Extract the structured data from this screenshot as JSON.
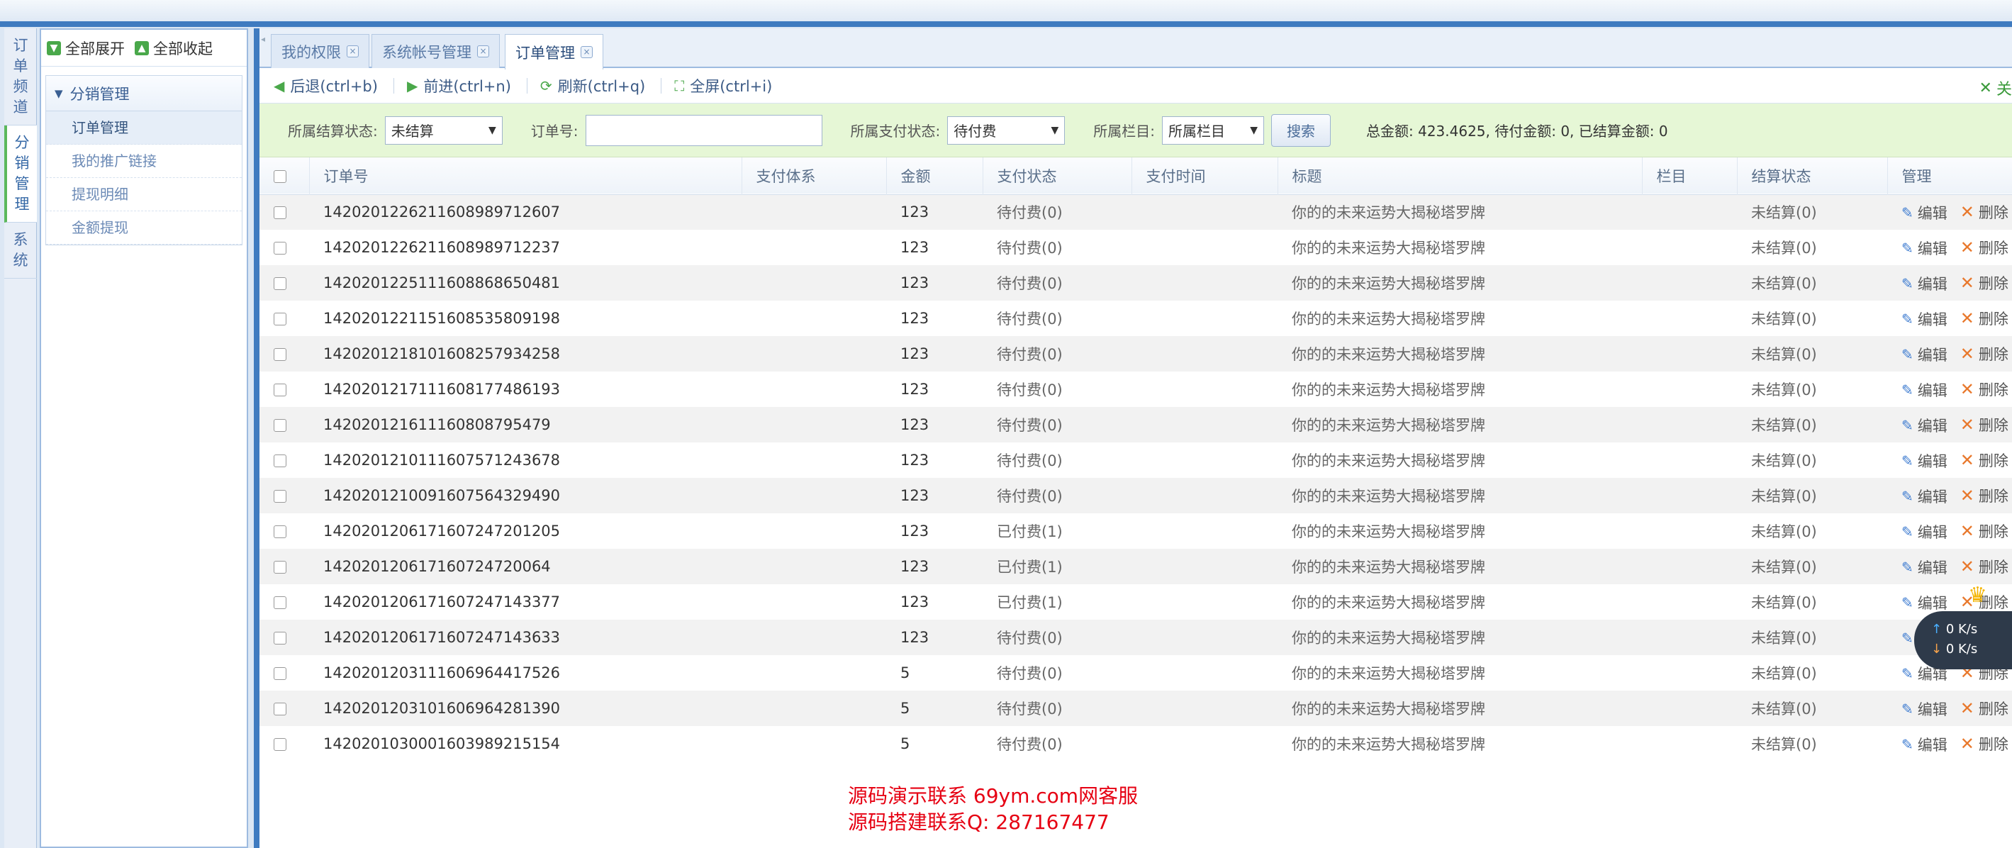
{
  "channels": [
    {
      "label": "订单频道",
      "active": false
    },
    {
      "label": "分销管理",
      "active": true
    },
    {
      "label": "系统",
      "active": false
    }
  ],
  "tree": {
    "expand_all": "全部展开",
    "collapse_all": "全部收起",
    "group": "分销管理",
    "items": [
      "订单管理",
      "我的推广链接",
      "提现明细",
      "金额提现"
    ]
  },
  "tabs": [
    {
      "label": "我的权限"
    },
    {
      "label": "系统帐号管理"
    },
    {
      "label": "订单管理"
    }
  ],
  "toolbar": {
    "back": "后退(ctrl+b)",
    "forward": "前进(ctrl+n)",
    "refresh": "刷新(ctrl+q)",
    "fullscreen": "全屏(ctrl+i)",
    "close_partial": "关"
  },
  "filter": {
    "settle_label": "所属结算状态:",
    "settle_value": "未结算",
    "order_label": "订单号:",
    "order_value": "",
    "pay_label": "所属支付状态:",
    "pay_value": "待付费",
    "column_label": "所属栏目:",
    "column_value": "所属栏目",
    "search_btn": "搜索",
    "summary": "总金额: 423.4625, 待付金额: 0, 已结算金额: 0"
  },
  "table": {
    "headers": [
      "订单号",
      "支付体系",
      "金额",
      "支付状态",
      "支付时间",
      "标题",
      "栏目",
      "结算状态",
      "管理"
    ],
    "edit_label": "编辑",
    "delete_label": "删除",
    "rows": [
      {
        "order": "14202012262116089897126​07",
        "system": "",
        "amount": "123",
        "pay": "待付费(0)",
        "time": "",
        "title": "你的的未来运势大揭秘塔罗牌",
        "column": "",
        "settle": "未结算(0)"
      },
      {
        "order": "142020122621160898971223​7",
        "system": "",
        "amount": "123",
        "pay": "待付费(0)",
        "time": "",
        "title": "你的的未来运势大揭秘塔罗牌",
        "column": "",
        "settle": "未结算(0)"
      },
      {
        "order": "1420201225111608868650481",
        "system": "",
        "amount": "123",
        "pay": "待付费(0)",
        "time": "",
        "title": "你的的未来运势大揭秘塔罗牌",
        "column": "",
        "settle": "未结算(0)"
      },
      {
        "order": "1420201221151608535809198",
        "system": "",
        "amount": "123",
        "pay": "待付费(0)",
        "time": "",
        "title": "你的的未来运势大揭秘塔罗牌",
        "column": "",
        "settle": "未结算(0)"
      },
      {
        "order": "1420201218101608257934258",
        "system": "",
        "amount": "123",
        "pay": "待付费(0)",
        "time": "",
        "title": "你的的未来运势大揭秘塔罗牌",
        "column": "",
        "settle": "未结算(0)"
      },
      {
        "order": "1420201217111608177486193",
        "system": "",
        "amount": "123",
        "pay": "待付费(0)",
        "time": "",
        "title": "你的的未来运势大揭秘塔罗牌",
        "column": "",
        "settle": "未结算(0)"
      },
      {
        "order": "142020121611160808795479",
        "system": "",
        "amount": "123",
        "pay": "待付费(0)",
        "time": "",
        "title": "你的的未来运势大揭秘塔罗牌",
        "column": "",
        "settle": "未结算(0)"
      },
      {
        "order": "1420201210111607571243678",
        "system": "",
        "amount": "123",
        "pay": "待付费(0)",
        "time": "",
        "title": "你的的未来运势大揭秘塔罗牌",
        "column": "",
        "settle": "未结算(0)"
      },
      {
        "order": "1420201210091607564329490",
        "system": "",
        "amount": "123",
        "pay": "待付费(0)",
        "time": "",
        "title": "你的的未来运势大揭秘塔罗牌",
        "column": "",
        "settle": "未结算(0)"
      },
      {
        "order": "1420201206171607247201205",
        "system": "",
        "amount": "123",
        "pay": "已付费(1)",
        "time": "",
        "title": "你的的未来运势大揭秘塔罗牌",
        "column": "",
        "settle": "未结算(0)"
      },
      {
        "order": "142020120617160724720064",
        "system": "",
        "amount": "123",
        "pay": "已付费(1)",
        "time": "",
        "title": "你的的未来运势大揭秘塔罗牌",
        "column": "",
        "settle": "未结算(0)"
      },
      {
        "order": "1420201206171607247143377",
        "system": "",
        "amount": "123",
        "pay": "已付费(1)",
        "time": "",
        "title": "你的的未来运势大揭秘塔罗牌",
        "column": "",
        "settle": "未结算(0)"
      },
      {
        "order": "1420201206171607247143633",
        "system": "",
        "amount": "123",
        "pay": "待付费(0)",
        "time": "",
        "title": "你的的未来运势大揭秘塔罗牌",
        "column": "",
        "settle": "未结算(0)"
      },
      {
        "order": "1420201203111606964417526",
        "system": "",
        "amount": "5",
        "pay": "待付费(0)",
        "time": "",
        "title": "你的的未来运势大揭秘塔罗牌",
        "column": "",
        "settle": "未结算(0)"
      },
      {
        "order": "1420201203101606964281390",
        "system": "",
        "amount": "5",
        "pay": "待付费(0)",
        "time": "",
        "title": "你的的未来运势大揭秘塔罗牌",
        "column": "",
        "settle": "未结算(0)"
      },
      {
        "order": "1420201030001603989215154",
        "system": "",
        "amount": "5",
        "pay": "待付费(0)",
        "time": "",
        "title": "你的的未来运势大揭秘塔罗牌",
        "column": "",
        "settle": "未结算(0)"
      }
    ]
  },
  "footer": {
    "line1": "源码演示联系 69ym.com网客服",
    "line2": "源码搭建联系Q: 287167477"
  },
  "netspeed": {
    "up": "0 K/s",
    "down": "0 K/s"
  },
  "colors": {
    "accent": "#3f7bc0",
    "filter_bg": "#e6f7d6",
    "footer_red": "#e60012",
    "delete_orange": "#e8782c"
  }
}
